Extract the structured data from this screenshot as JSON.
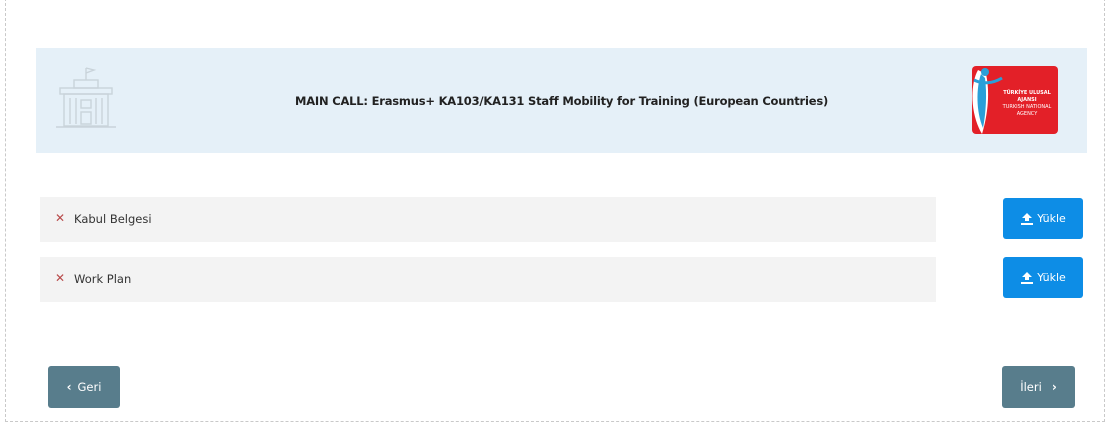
{
  "header": {
    "title": "MAIN CALL: Erasmus+ KA103/KA131 Staff Mobility for Training (European Countries)",
    "logo_text_line1": "TÜRKİYE ULUSAL AJANSI",
    "logo_text_line2": "TURKISH NATIONAL AGENCY",
    "icon": "building-icon"
  },
  "documents": [
    {
      "label": "Kabul Belgesi",
      "status_icon": "close-icon",
      "upload_label": "Yükle"
    },
    {
      "label": "Work Plan",
      "status_icon": "close-icon",
      "upload_label": "Yükle"
    }
  ],
  "navigation": {
    "back_label": "Geri",
    "next_label": "İleri"
  },
  "colors": {
    "header_bg": "#e5f0f8",
    "upload_button": "#0d8de6",
    "nav_button": "#587d8c",
    "row_bg": "#f3f3f3",
    "logo_red": "#e32028"
  }
}
